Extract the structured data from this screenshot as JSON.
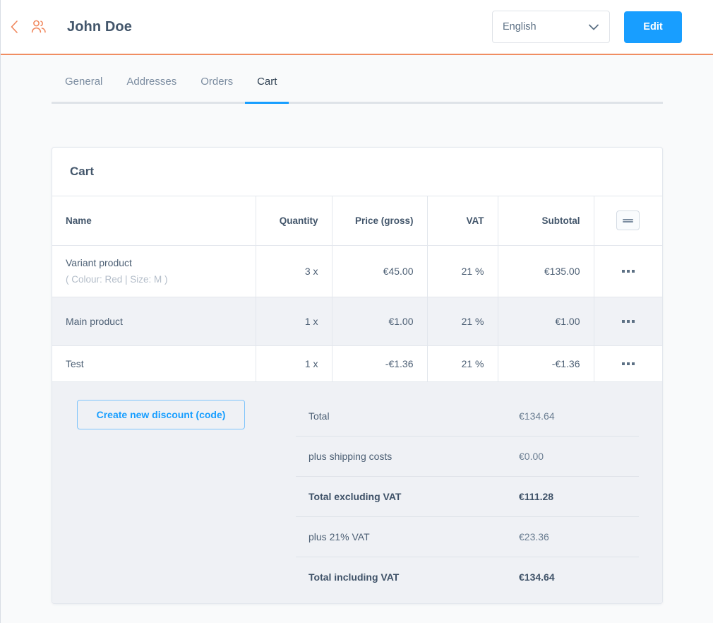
{
  "header": {
    "back_icon": "chevron-left-icon",
    "users_icon": "users-icon",
    "title": "John Doe",
    "language": {
      "value": "English",
      "chevron_icon": "chevron-down-icon"
    },
    "edit_label": "Edit",
    "accent_orange": "#f08d61",
    "accent_blue": "#189eff"
  },
  "tabs": [
    {
      "label": "General",
      "active": false
    },
    {
      "label": "Addresses",
      "active": false
    },
    {
      "label": "Orders",
      "active": false
    },
    {
      "label": "Cart",
      "active": true
    }
  ],
  "card": {
    "title": "Cart",
    "table": {
      "columns": [
        {
          "label": "Name",
          "align": "left"
        },
        {
          "label": "Quantity",
          "align": "right"
        },
        {
          "label": "Price (gross)",
          "align": "right"
        },
        {
          "label": "VAT",
          "align": "right"
        },
        {
          "label": "Subtotal",
          "align": "right"
        },
        {
          "label": "",
          "align": "center",
          "icon": "column-settings-icon"
        }
      ],
      "rows": [
        {
          "name": "Variant product",
          "variant": "( Colour: Red | Size: M )",
          "quantity": "3 x",
          "price": "€45.00",
          "vat": "21 %",
          "subtotal": "€135.00",
          "actions_icon": "more-options-icon"
        },
        {
          "name": "Main product",
          "variant": "",
          "quantity": "1 x",
          "price": "€1.00",
          "vat": "21 %",
          "subtotal": "€1.00",
          "actions_icon": "more-options-icon"
        },
        {
          "name": "Test",
          "variant": "",
          "quantity": "1 x",
          "price": "-€1.36",
          "vat": "21 %",
          "subtotal": "-€1.36",
          "actions_icon": "more-options-icon"
        }
      ]
    },
    "discount_button": "Create new discount (code)",
    "summary": [
      {
        "label": "Total",
        "value": "€134.64",
        "strong": false
      },
      {
        "label": "plus shipping costs",
        "value": "€0.00",
        "strong": false
      },
      {
        "label": "Total excluding VAT",
        "value": "€111.28",
        "strong": true
      },
      {
        "label": "plus 21% VAT",
        "value": "€23.36",
        "strong": false
      },
      {
        "label": "Total including VAT",
        "value": "€134.64",
        "strong": true
      }
    ]
  }
}
